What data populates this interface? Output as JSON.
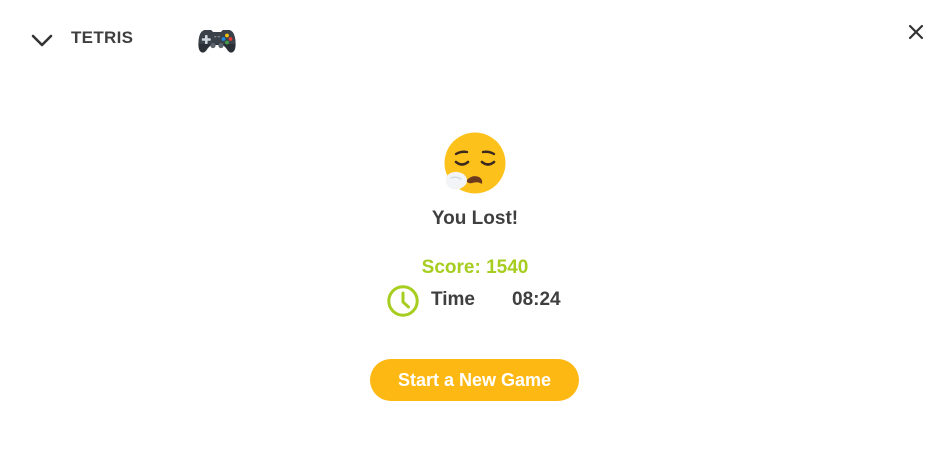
{
  "header": {
    "title": "TETRIS",
    "collapse_icon": "chevron-down-icon",
    "game_icon": "gamepad-icon",
    "close_icon": "close-icon"
  },
  "result": {
    "face_icon": "sad-relieved-face-icon",
    "message": "You Lost!",
    "score": "Score: 1540",
    "time_icon": "clock-icon",
    "time_label": "Time",
    "time_value": "08:24"
  },
  "actions": {
    "new_game_label": "Start a New Game"
  },
  "colors": {
    "text": "#3f3f3f",
    "score": "#a6cd1f",
    "clock": "#a6cd1f",
    "button": "#fdb813",
    "button_text": "#ffffff",
    "face": "#fcc21b"
  }
}
